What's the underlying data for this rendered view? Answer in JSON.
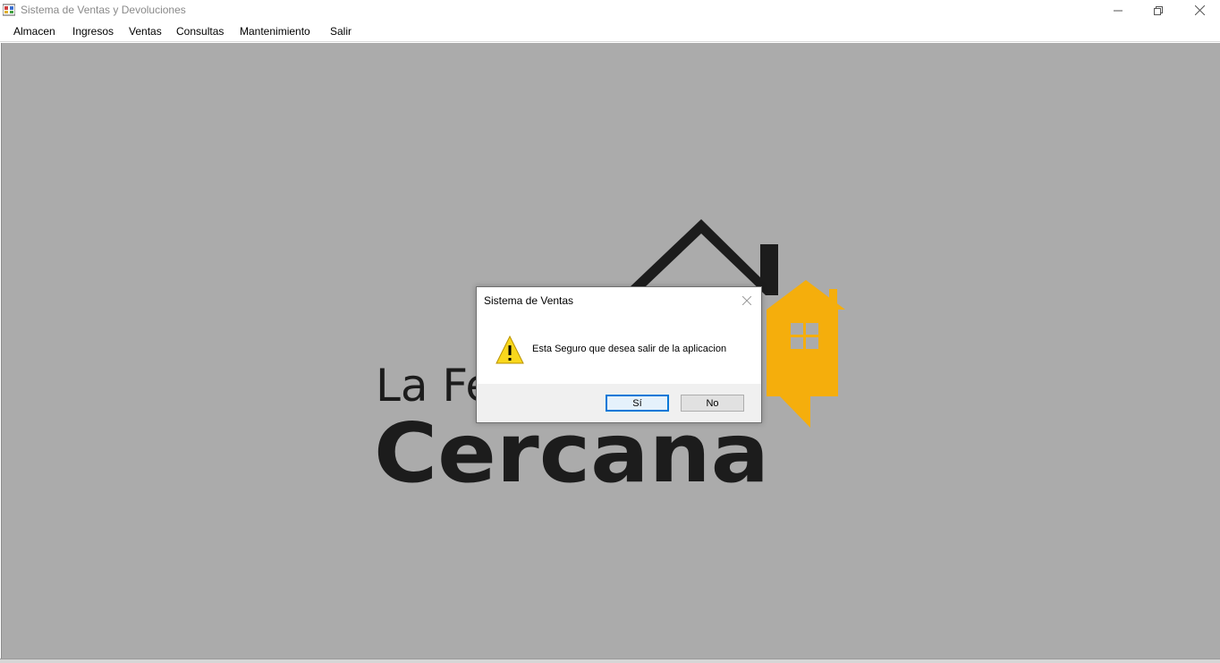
{
  "window": {
    "title": "Sistema de Ventas y Devoluciones"
  },
  "menu": {
    "items": [
      {
        "label": "Almacen"
      },
      {
        "label": "Ingresos"
      },
      {
        "label": "Ventas"
      },
      {
        "label": "Consultas"
      },
      {
        "label": "Mantenimiento"
      },
      {
        "label": "Salir"
      }
    ]
  },
  "logo": {
    "line1": "La Fe",
    "line2": "Cercana",
    "accent_color": "#f5ae0c",
    "dark_color": "#1c1c1c"
  },
  "dialog": {
    "title": "Sistema de Ventas",
    "message": "Esta Seguro que desea salir de la aplicacion",
    "yes_label": "Sí",
    "no_label": "No",
    "icon": "warning-icon"
  },
  "colors": {
    "background": "#ababab",
    "accent_focus": "#0078d7"
  }
}
